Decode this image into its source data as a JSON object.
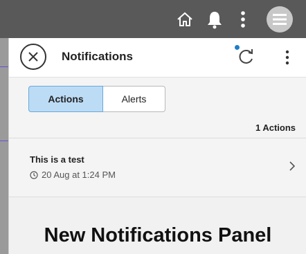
{
  "topbar": {
    "icons": [
      "home-icon",
      "bell-icon",
      "vertical-dots-icon",
      "hamburger-menu-icon"
    ]
  },
  "panel": {
    "title": "Notifications",
    "close_icon": "close-circle-icon",
    "refresh_icon": "refresh-icon",
    "more_icon": "vertical-dots-icon"
  },
  "tabs": [
    {
      "label": "Actions",
      "selected": true
    },
    {
      "label": "Alerts",
      "selected": false
    }
  ],
  "count_text": "1 Actions",
  "notifications": [
    {
      "title": "This is a test",
      "time": "20 Aug at 1:24 PM"
    }
  ],
  "banner_text": "New Notifications Panel",
  "colors": {
    "accent": "#1f7ec8",
    "tab_selected_bg": "#bcdcf6",
    "topbar_bg": "#595959"
  }
}
